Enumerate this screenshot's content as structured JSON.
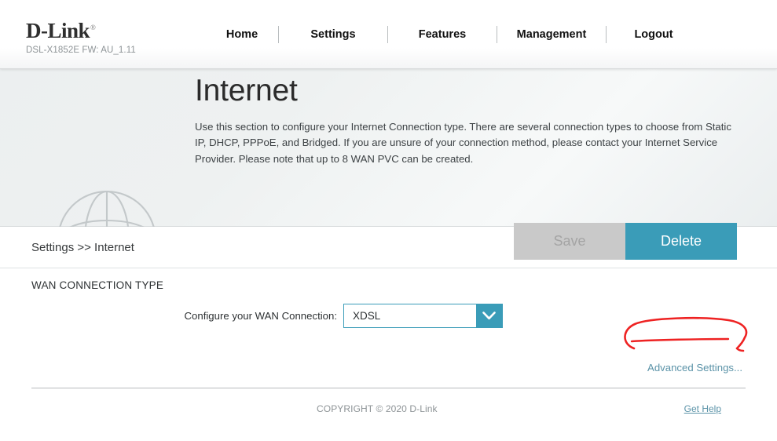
{
  "header": {
    "brand": "D-Link",
    "registered_mark": "®",
    "model_fw": "DSL-X1852E  FW: AU_1.11",
    "nav": [
      {
        "label": "Home"
      },
      {
        "label": "Settings"
      },
      {
        "label": "Features"
      },
      {
        "label": "Management"
      },
      {
        "label": "Logout"
      }
    ]
  },
  "hero": {
    "icon": "globe-icon",
    "title": "Internet",
    "description": "Use this section to configure your Internet Connection type. There are several connection types to choose from Static IP, DHCP, PPPoE, and Bridged. If you are unsure of your connection method, please contact your Internet Service Provider. Please note that up to 8 WAN PVC can be created."
  },
  "actionbar": {
    "breadcrumb": "Settings >> Internet",
    "save_label": "Save",
    "delete_label": "Delete"
  },
  "main": {
    "section_title": "WAN CONNECTION TYPE",
    "wan_field_label": "Configure your WAN Connection:",
    "wan_value": "XDSL",
    "wan_options": [
      "XDSL"
    ],
    "dropdown_icon": "chevron-down-icon",
    "advanced_link": "Advanced Settings..."
  },
  "annotation": {
    "shape": "hand-drawn-red-ellipse",
    "color": "#ee2222",
    "target": "Advanced Settings..."
  },
  "footer": {
    "copyright": "COPYRIGHT © 2020 D-Link",
    "help_link": "Get Help"
  },
  "colors": {
    "accent_teal": "#3a9cb8",
    "disabled_gray": "#c9c9c9",
    "link_teal": "#5b93a8",
    "annotation_red": "#ee2222"
  }
}
